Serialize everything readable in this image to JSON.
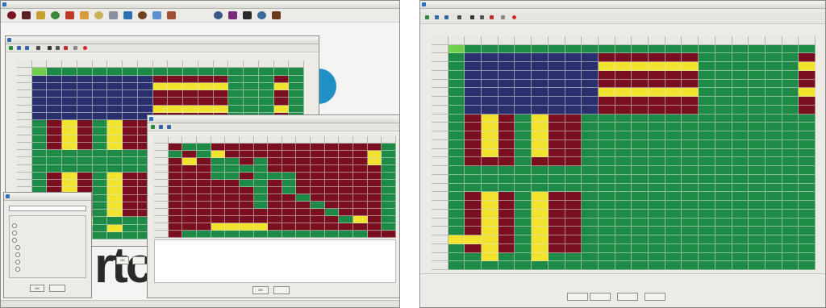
{
  "left_app": {
    "title": "",
    "toolbar_icons": [
      "sphere-icon",
      "cube-icon",
      "axis-icon",
      "check-icon",
      "pen-icon",
      "ring-icon",
      "gear-icon",
      "globe-icon",
      "rectangle-icon",
      "figure-icon",
      "sphere-icon",
      "wrench-icon",
      "cylinder-icon",
      "disc-icon",
      "hash-icon",
      "arrow-icon",
      "chart-icon"
    ],
    "matrix_window": {
      "title": ""
    },
    "small_matrix_window": {
      "title": ""
    },
    "dialog": {
      "title": "",
      "options": [
        "",
        "",
        "",
        "",
        "",
        "",
        ""
      ],
      "ok_label": "OK",
      "cancel_label": ""
    },
    "popup_buttons": {
      "ok": "OK",
      "cancel": ""
    },
    "status_fields": [
      "",
      "",
      "",
      "",
      "",
      "",
      ""
    ],
    "background_letters": "rtc"
  },
  "right_app": {
    "title": "",
    "buttons": [
      "",
      "",
      "",
      ""
    ]
  },
  "colors": {
    "green": "#1d8a46",
    "navy": "#2a2f6e",
    "maroon": "#7a0f1f",
    "yellow": "#f2e42e",
    "light_green": "#6fcf4c",
    "accent_blue": "#1f8fc4"
  }
}
